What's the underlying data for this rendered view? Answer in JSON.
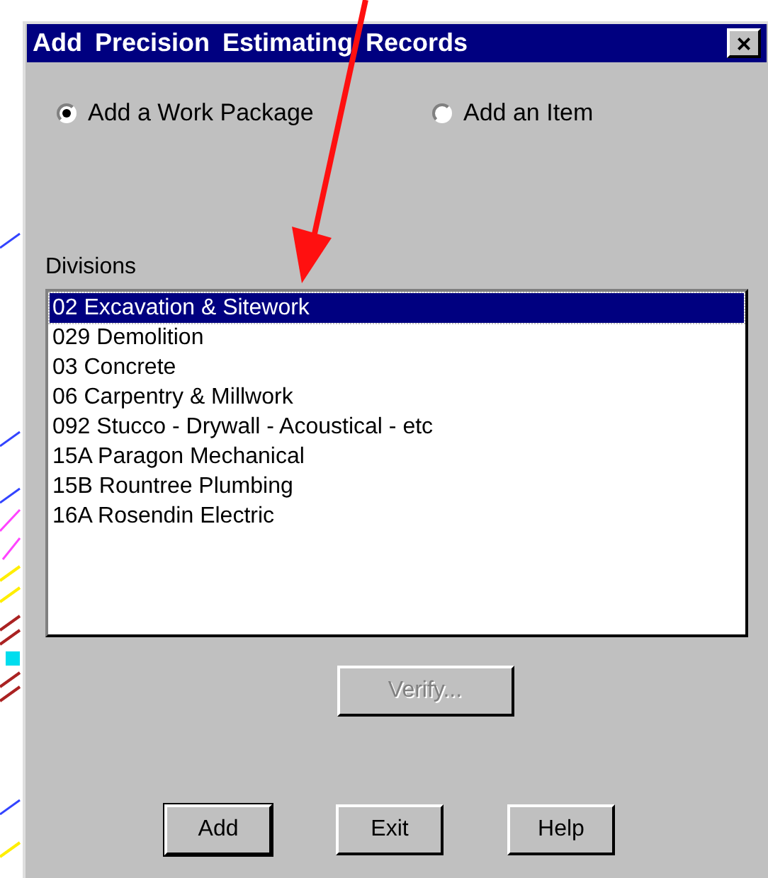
{
  "window": {
    "title": "Add Precision Estimating Records",
    "close": "×"
  },
  "options": [
    {
      "label": "Add a Work Package",
      "selected": true
    },
    {
      "label": "Add an Item",
      "selected": false
    }
  ],
  "divisions": {
    "label": "Divisions",
    "items": [
      {
        "label": "02 Excavation & Sitework",
        "selected": true
      },
      {
        "label": "029 Demolition",
        "selected": false
      },
      {
        "label": "03 Concrete",
        "selected": false
      },
      {
        "label": "06 Carpentry & Millwork",
        "selected": false
      },
      {
        "label": "092 Stucco - Drywall - Acoustical - etc",
        "selected": false
      },
      {
        "label": "15A Paragon Mechanical",
        "selected": false
      },
      {
        "label": "15B Rountree Plumbing",
        "selected": false
      },
      {
        "label": "16A Rosendin Electric",
        "selected": false
      }
    ]
  },
  "verify_button": {
    "label": "Verify...",
    "disabled": true
  },
  "buttons": [
    {
      "label": "Add",
      "default": true
    },
    {
      "label": "Exit",
      "default": false
    },
    {
      "label": "Help",
      "default": false
    }
  ]
}
